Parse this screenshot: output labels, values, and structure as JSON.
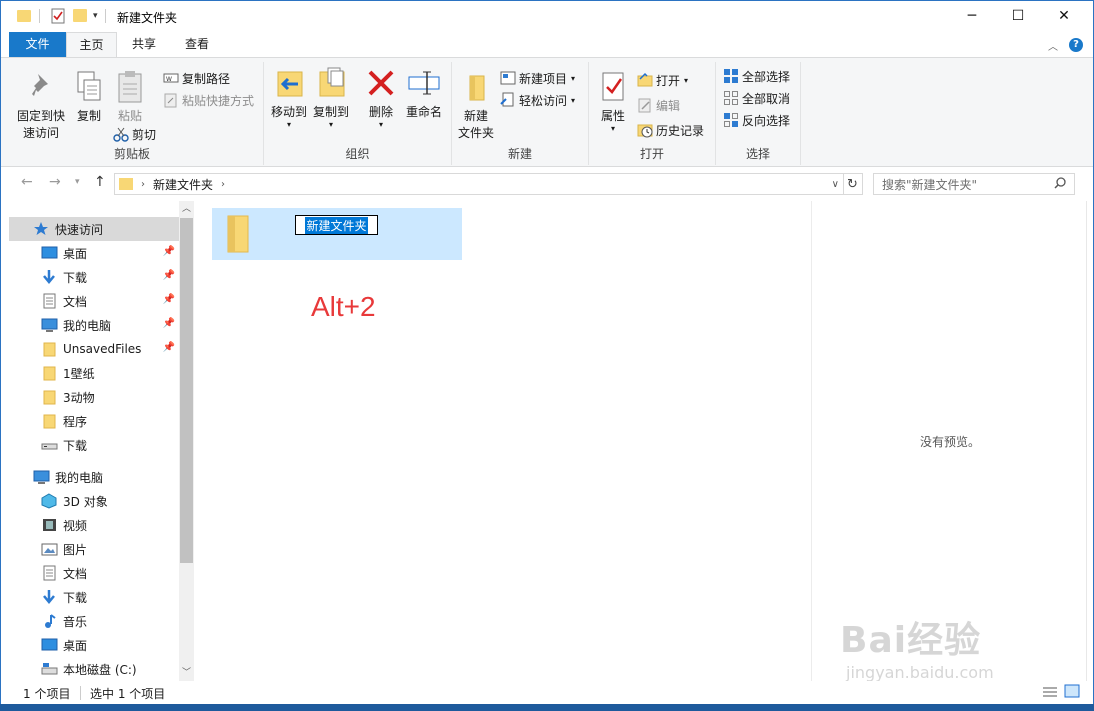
{
  "window": {
    "title": "新建文件夹"
  },
  "tabs": {
    "file": "文件",
    "home": "主页",
    "share": "共享",
    "view": "查看"
  },
  "ribbon": {
    "clipboard": {
      "label": "剪贴板",
      "pin_quick_1": "固定到快",
      "pin_quick_2": "速访问",
      "copy": "复制",
      "paste": "粘贴",
      "copy_path": "复制路径",
      "paste_shortcut": "粘贴快捷方式",
      "cut": "剪切"
    },
    "organize": {
      "label": "组织",
      "move_to": "移动到",
      "copy_to": "复制到",
      "delete": "删除",
      "rename": "重命名"
    },
    "new": {
      "label": "新建",
      "new_folder_1": "新建",
      "new_folder_2": "文件夹",
      "new_item": "新建项目",
      "easy_access": "轻松访问"
    },
    "open": {
      "label": "打开",
      "properties": "属性",
      "open": "打开",
      "edit": "编辑",
      "history": "历史记录"
    },
    "select": {
      "label": "选择",
      "select_all": "全部选择",
      "select_none": "全部取消",
      "invert": "反向选择"
    }
  },
  "address": {
    "path": "新建文件夹",
    "search_placeholder": "搜索\"新建文件夹\""
  },
  "nav": {
    "quick_access": "快速访问",
    "quick_items": [
      {
        "label": "桌面",
        "pinned": true
      },
      {
        "label": "下载",
        "pinned": true
      },
      {
        "label": "文档",
        "pinned": true
      },
      {
        "label": "我的电脑",
        "pinned": true
      },
      {
        "label": "UnsavedFiles",
        "pinned": true
      },
      {
        "label": "1壁纸",
        "pinned": false
      },
      {
        "label": "3动物",
        "pinned": false
      },
      {
        "label": "程序",
        "pinned": false
      },
      {
        "label": "下载",
        "pinned": false
      }
    ],
    "this_pc": "我的电脑",
    "pc_items": [
      "3D 对象",
      "视频",
      "图片",
      "文档",
      "下载",
      "音乐",
      "桌面",
      "本地磁盘 (C:)"
    ]
  },
  "content": {
    "rename_value": "新建文件夹",
    "annotation": "Alt+2"
  },
  "preview": {
    "empty": "没有预览。"
  },
  "status": {
    "count": "1 个项目",
    "selected": "选中 1 个项目"
  },
  "watermark": {
    "brand": "Bai经验",
    "url": "jingyan.baidu.com"
  },
  "colors": {
    "accent": "#1979ca",
    "selection": "#cce8ff",
    "annotation": "#e8393a",
    "folder": "#f8d775"
  }
}
